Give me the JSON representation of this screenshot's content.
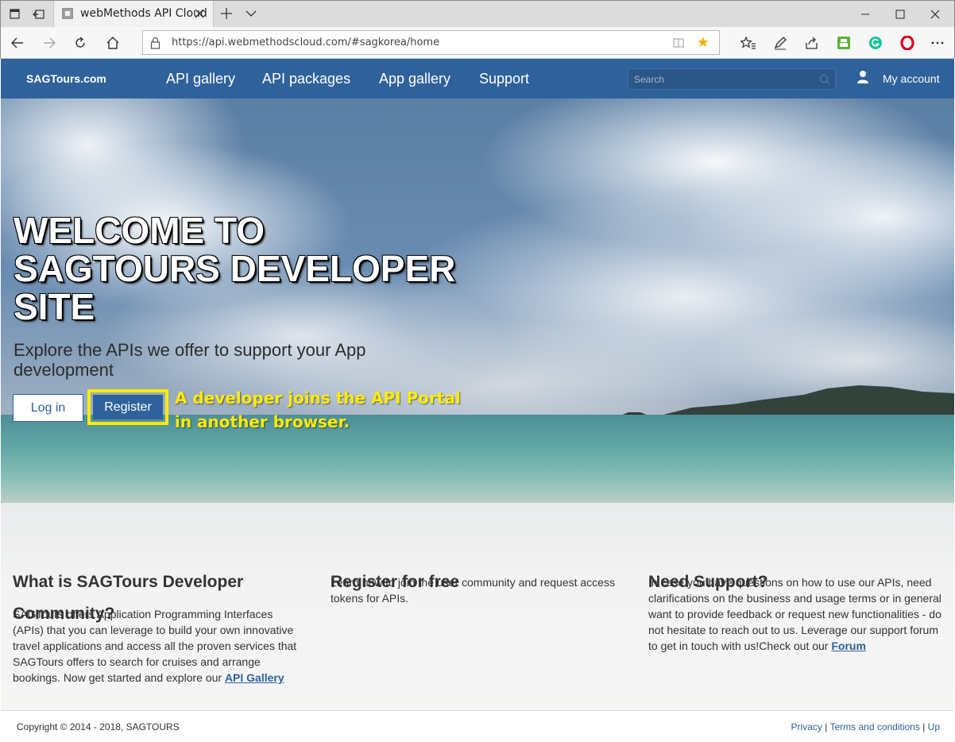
{
  "browser": {
    "tab_title": "webMethods API Cloud",
    "url": "https://api.webmethodscloud.com/#sagkorea/home"
  },
  "header": {
    "brand": "SAGTours.com",
    "nav": [
      "API gallery",
      "API packages",
      "App gallery",
      "Support"
    ],
    "search_placeholder": "Search",
    "account_label": "My account"
  },
  "hero": {
    "title": "WELCOME TO SAGTOURS DEVELOPER SITE",
    "subtitle": "Explore the APIs we offer to support your App development",
    "login_label": "Log in",
    "register_label": "Register",
    "annotation_line1": "A developer joins the API Portal",
    "annotation_line2": "in another browser.",
    "highlight_color": "#ffeb00"
  },
  "columns": [
    {
      "heading": "What is SAGTours Developer Community?",
      "text": "SAGTours offers Application Programming Interfaces (APIs) that you can leverage to build your own innovative travel applications and access all the proven services that SAGTours offers to search for cruises and arrange bookings. Now get started and explore our",
      "link": "API Gallery"
    },
    {
      "heading": "Register for free",
      "text": "Learn how to join the user community and request access tokens for APIs."
    },
    {
      "heading": "Need Support?",
      "text": "In case you have questions on how to use our APIs, need clarifications on the business and usage terms or in general want to provide feedback or request new functionalities - do not hesitate to reach out to us. Leverage our support forum to get in touch with us!Check out our",
      "link": "Forum"
    }
  ],
  "footer": {
    "copyright": "Copyright © 2014 - 2018, SAGTOURS",
    "links": [
      "Privacy",
      "Terms and conditions",
      "Up"
    ]
  },
  "colors": {
    "brand_blue": "#2f629a"
  }
}
